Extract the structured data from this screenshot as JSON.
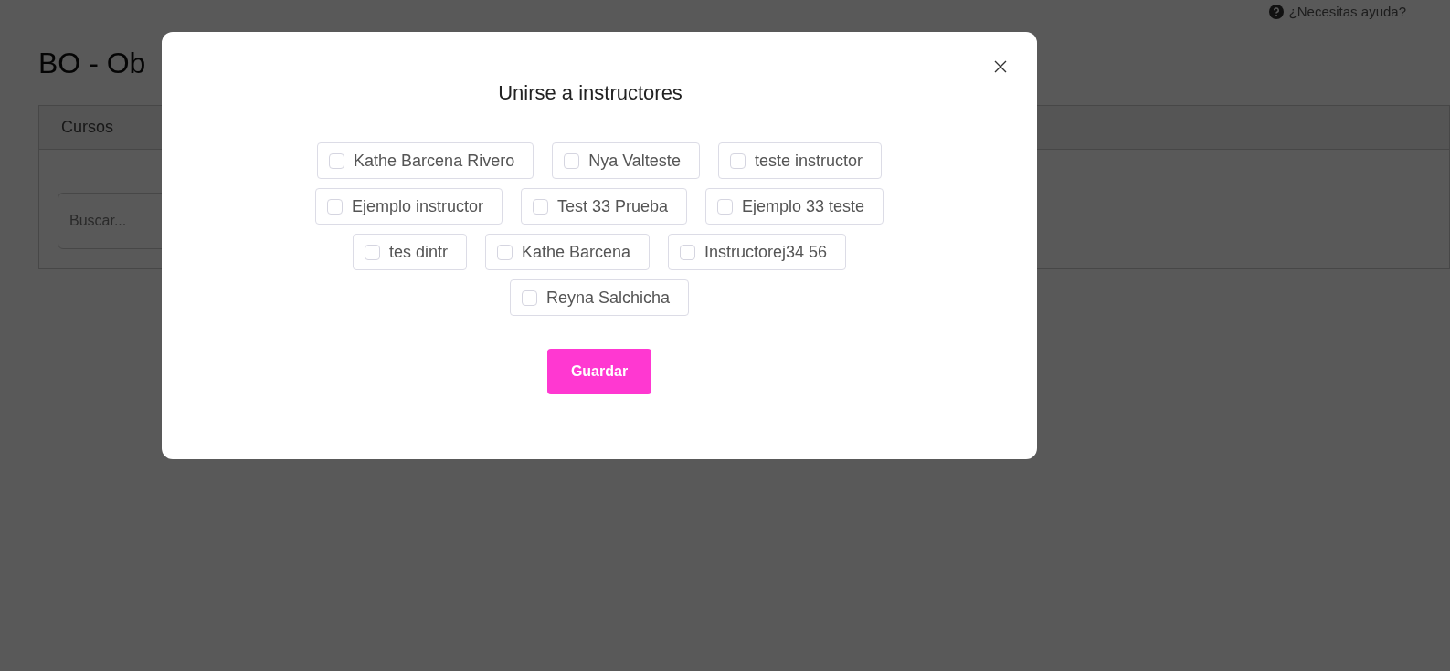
{
  "help_link": "¿Necesitas ayuda?",
  "page_title": "BO - Ob",
  "card": {
    "header": "Cursos",
    "search": {
      "placeholder": "Buscar..."
    }
  },
  "modal": {
    "title": "Unirse a instructores",
    "instructors": [
      {
        "label": "Kathe Barcena Rivero",
        "checked": false
      },
      {
        "label": "Nya Valteste",
        "checked": false
      },
      {
        "label": "teste instructor",
        "checked": false
      },
      {
        "label": "Ejemplo instructor",
        "checked": false
      },
      {
        "label": "Test 33 Prueba",
        "checked": false
      },
      {
        "label": "Ejemplo 33 teste",
        "checked": false
      },
      {
        "label": "tes dintr",
        "checked": false
      },
      {
        "label": "Kathe Barcena",
        "checked": false
      },
      {
        "label": "Instructorej34 56",
        "checked": false
      },
      {
        "label": "Reyna Salchicha",
        "checked": false
      }
    ],
    "button": "Guardar"
  }
}
